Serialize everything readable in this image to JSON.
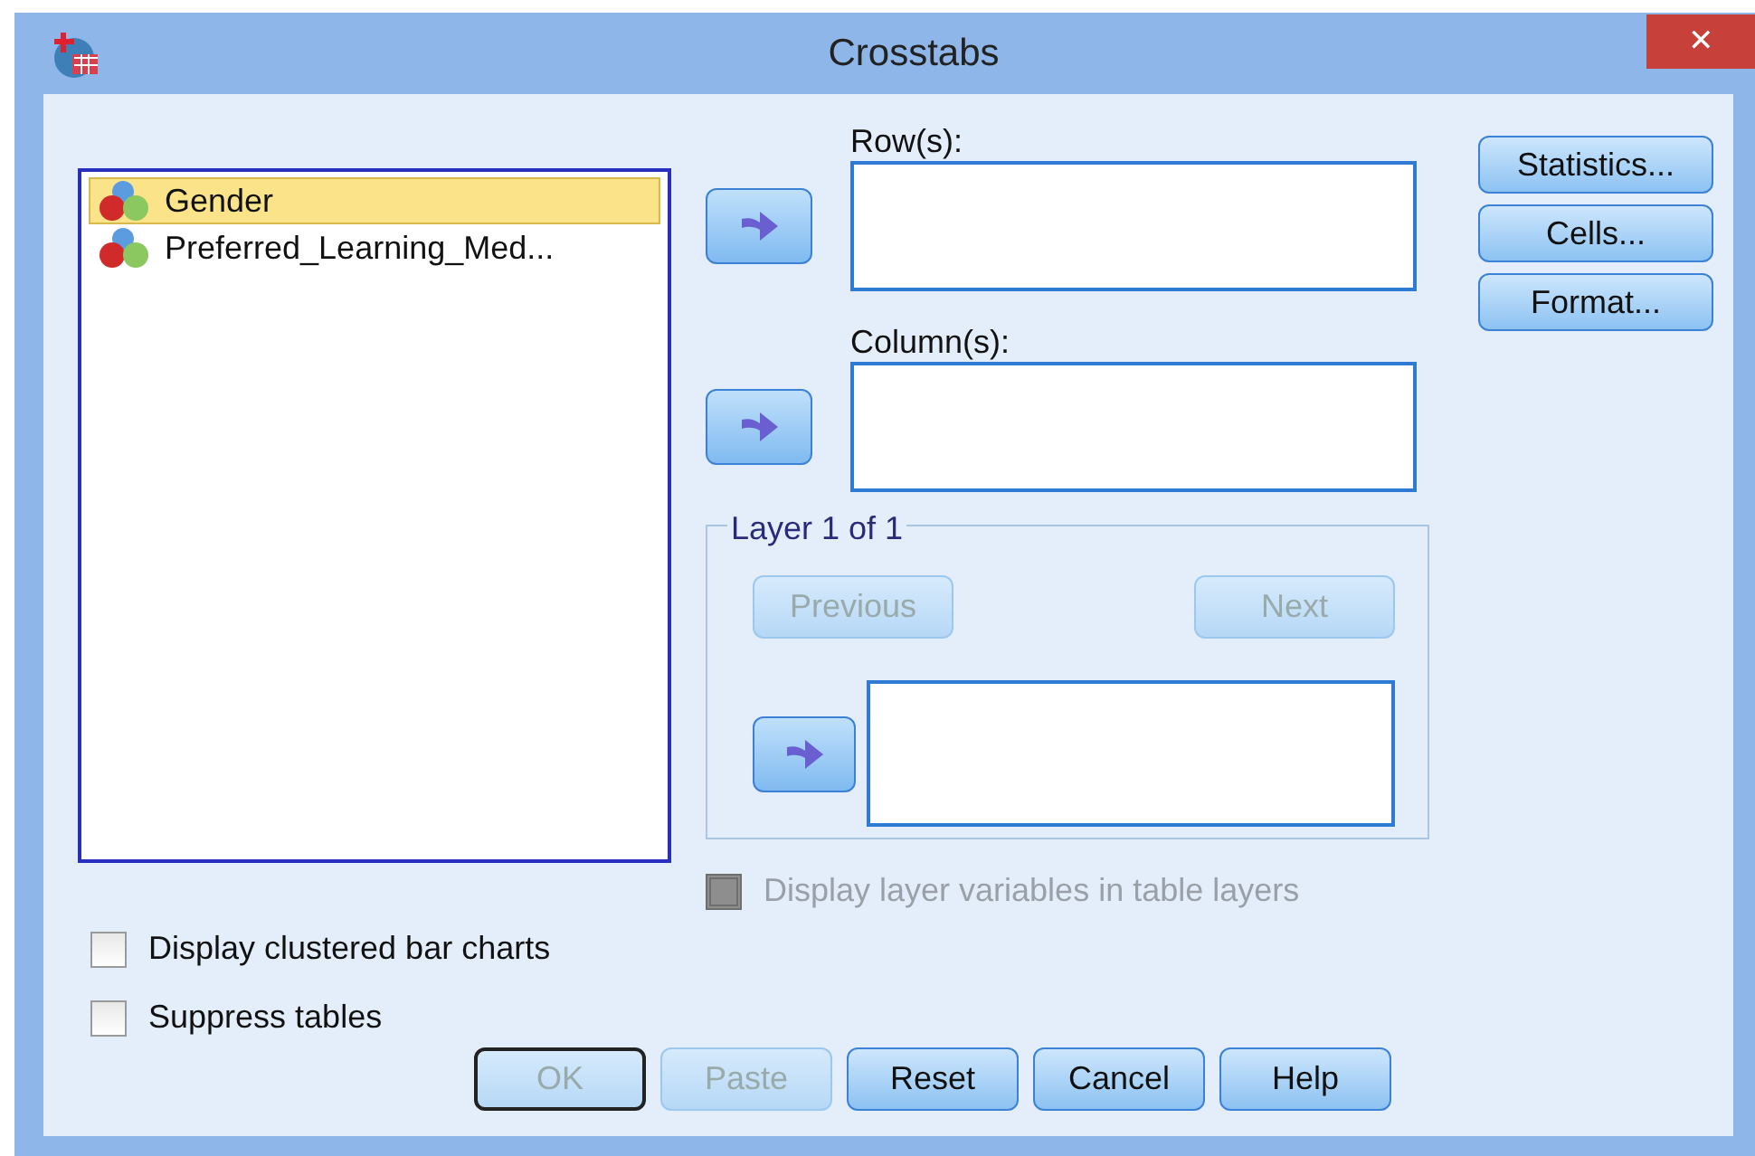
{
  "window": {
    "title": "Crosstabs",
    "close": "✕"
  },
  "variables": [
    {
      "label": "Gender",
      "selected": true
    },
    {
      "label": "Preferred_Learning_Med...",
      "selected": false
    }
  ],
  "targets": [
    {
      "label": "Row(s):"
    },
    {
      "label": "Column(s):"
    }
  ],
  "side_buttons": [
    "Statistics...",
    "Cells...",
    "Format..."
  ],
  "layer": {
    "title": "Layer 1 of 1",
    "buttons": [
      {
        "label": "Previous",
        "disabled": true
      },
      {
        "label": "Next",
        "disabled": true
      }
    ]
  },
  "layer_option": {
    "label": "Display layer variables in table layers",
    "checked": false,
    "disabled": true
  },
  "options": [
    {
      "label": "Display clustered bar charts",
      "checked": false
    },
    {
      "label": "Suppress tables",
      "checked": false
    }
  ],
  "buttons": [
    {
      "label": "OK",
      "disabled": true,
      "default": true
    },
    {
      "label": "Paste",
      "disabled": true,
      "default": false
    },
    {
      "label": "Reset",
      "disabled": false,
      "default": false
    },
    {
      "label": "Cancel",
      "disabled": false,
      "default": false
    },
    {
      "label": "Help",
      "disabled": false,
      "default": false
    }
  ]
}
